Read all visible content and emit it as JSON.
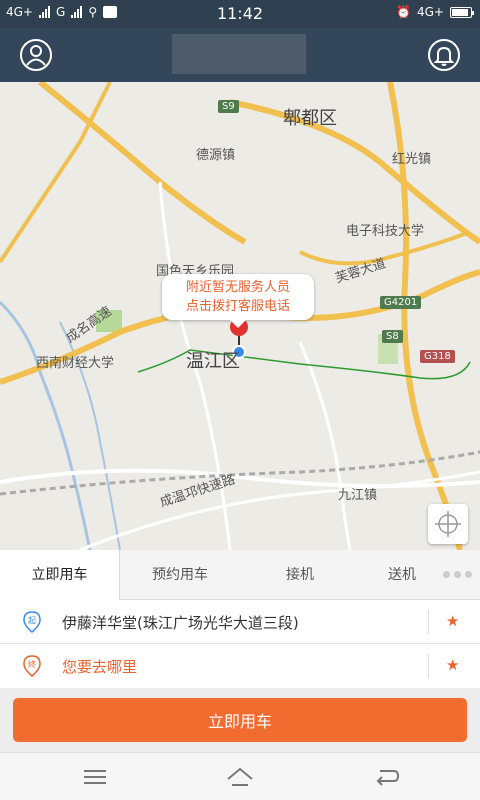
{
  "status_bar": {
    "network_left": "4G+",
    "carrier": "G",
    "time": "11:42",
    "network_right": "4G+",
    "icons": [
      "signal-icon",
      "usb-icon",
      "notification-icon",
      "alarm-icon",
      "battery-icon"
    ]
  },
  "header": {
    "icons": [
      "user-icon",
      "bell-icon"
    ]
  },
  "map": {
    "district_labels": [
      "郫都区",
      "温江区"
    ],
    "place_labels": [
      "德源镇",
      "红光镇",
      "电子科技大学",
      "国色天乡乐园",
      "西南财经大学",
      "九江镇"
    ],
    "road_labels": [
      "芙蓉大道",
      "成名高速",
      "成温邛快速路"
    ],
    "shields": [
      "S9",
      "G4201",
      "S8",
      "G318"
    ],
    "callout_lines": [
      "附近暂无服务人员",
      "点击拨打客服电话"
    ],
    "colors": {
      "callout_text": "#e8632e",
      "route": "#2e9a2e",
      "pin": "#e03030"
    }
  },
  "tabs": [
    {
      "label": "立即用车",
      "active": true
    },
    {
      "label": "预约用车",
      "active": false
    },
    {
      "label": "接机",
      "active": false
    },
    {
      "label": "送机",
      "active": false
    }
  ],
  "pickup": {
    "icon_text": "起",
    "text": "伊藤洋华堂(珠江广场光华大道三段)",
    "star": "★"
  },
  "destination": {
    "icon_text": "终",
    "text": "您要去哪里",
    "star": "★"
  },
  "main_button": {
    "label": "立即用车",
    "color": "#f26b2f"
  },
  "navbar": {
    "icons": [
      "menu-icon",
      "home-icon",
      "back-icon"
    ]
  }
}
